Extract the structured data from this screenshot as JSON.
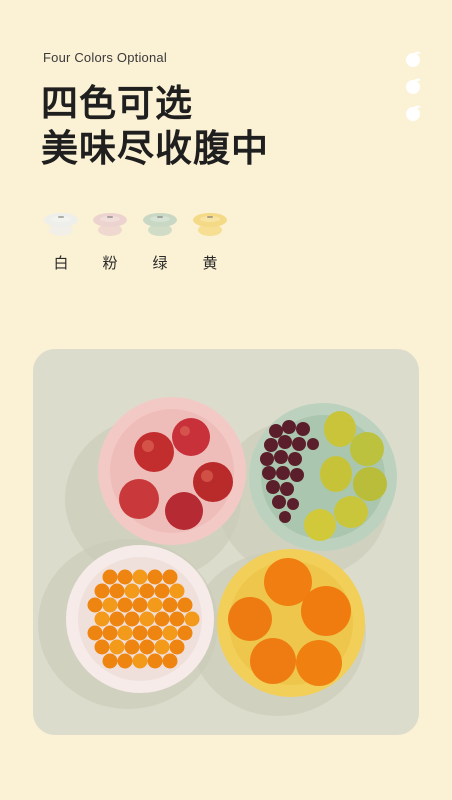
{
  "header": {
    "subtitle": "Four Colors Optional",
    "title_line1": "四色可选",
    "title_line2": "美味尽收腹中"
  },
  "side_icons": [
    "fruit-icon",
    "fruit-icon",
    "fruit-icon"
  ],
  "colors": [
    {
      "label": "白",
      "color": "#eeeeea"
    },
    {
      "label": "粉",
      "color": "#ecd3cf"
    },
    {
      "label": "绿",
      "color": "#c9d8c4"
    },
    {
      "label": "黄",
      "color": "#f4da86"
    }
  ],
  "photo": {
    "background": "#dcdccc",
    "bowls": [
      {
        "color": "#f3c9c6",
        "fruit": "apples"
      },
      {
        "color": "#bcd2bf",
        "fruit": "grapes-and-pears"
      },
      {
        "color": "#f6ebe8",
        "fruit": "kumquats"
      },
      {
        "color": "#f1cf58",
        "fruit": "oranges"
      }
    ]
  }
}
